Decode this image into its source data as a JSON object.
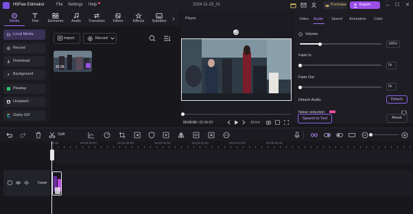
{
  "app": {
    "name": "HitPaw Edimakor",
    "menu": [
      "File",
      "Settings",
      "Help"
    ],
    "doc_title": "2024-11-23_01",
    "purchase_label": "Purchase",
    "export_label": "Export",
    "accent": "#9a4fe8",
    "window_controls": [
      "–",
      "☐",
      "✕"
    ]
  },
  "toolbar": {
    "tabs": [
      {
        "label": "Media",
        "icon": "media-icon"
      },
      {
        "label": "Text",
        "icon": "text-icon"
      },
      {
        "label": "Elements",
        "icon": "elements-icon"
      },
      {
        "label": "Audio",
        "icon": "audio-icon"
      },
      {
        "label": "Transition",
        "icon": "transition-icon"
      },
      {
        "label": "Filters",
        "icon": "filters-icon"
      },
      {
        "label": "Effects",
        "icon": "effects-icon"
      },
      {
        "label": "Subtitles",
        "icon": "subtitles-icon"
      }
    ]
  },
  "leftnav": {
    "items": [
      {
        "label": "Local Media"
      },
      {
        "label": "Record"
      },
      {
        "label": "Download"
      },
      {
        "label": "Background"
      },
      {
        "label": "Pixabay"
      },
      {
        "label": "Unsplash"
      },
      {
        "label": "Giphy GIF"
      }
    ]
  },
  "media": {
    "import_label": "Import",
    "record_label": "Record",
    "thumb_duration": "42:28"
  },
  "player": {
    "title": "Player",
    "current_time": "00:00:00",
    "total_time": "02:06:03",
    "ratio": "16:9"
  },
  "panel": {
    "tabs": [
      "Video",
      "Audio",
      "Speed",
      "Animation",
      "Color"
    ],
    "active_tab": "Audio",
    "volume_label": "Volume",
    "volume_value": "100%",
    "fade_in_label": "Fade In",
    "fade_in_value": "0s",
    "fade_out_label": "Fade Out",
    "fade_out_value": "0s",
    "detach_audio_label": "Detach Audio",
    "detach_button": "Detach",
    "noise_label": "Noise reduction",
    "speech_to_text": "Speech to Text",
    "reset": "Reset"
  },
  "timeline": {
    "split_label": "Split",
    "ruler": [
      "00:00",
      "00:00:30:00",
      "00:01:40:00",
      "00:02:30:00",
      "00:03:20:00",
      "00:04:10:00",
      "00:05:00:00"
    ],
    "cover_label": "Cover"
  }
}
